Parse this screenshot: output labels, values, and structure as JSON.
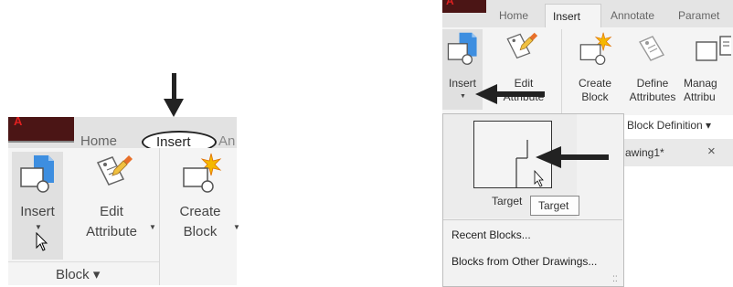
{
  "left": {
    "app_button": "A",
    "tabs": {
      "home": "Home",
      "insert": "Insert",
      "annotate_partial": "An"
    },
    "buttons": {
      "insert": "Insert",
      "edit_attribute_line1": "Edit",
      "edit_attribute_line2": "Attribute",
      "create_block_line1": "Create",
      "create_block_line2": "Block"
    },
    "panel_title": "Block ▾"
  },
  "right": {
    "app_button": "A",
    "tabs": {
      "home": "Home",
      "insert": "Insert",
      "annotate": "Annotate",
      "parametric_partial": "Paramet"
    },
    "buttons": {
      "insert": "Insert",
      "edit_attribute_line1": "Edit",
      "edit_attribute_line2": "Attribute",
      "create_block_line1": "Create",
      "create_block_line2": "Block",
      "define_attributes_line1": "Define",
      "define_attributes_line2": "Attributes",
      "manage_attributes_line1": "Manag",
      "manage_attributes_line2": "Attribu"
    },
    "block_definition": "Block Definition ▾",
    "drawing_tab": "awing1*",
    "drawing_tab_close": "×",
    "gallery": {
      "block_name": "Target",
      "tooltip": "Target"
    },
    "menu": {
      "recent_blocks": "Recent Blocks...",
      "blocks_from_other": "Blocks from Other Drawings..."
    }
  }
}
